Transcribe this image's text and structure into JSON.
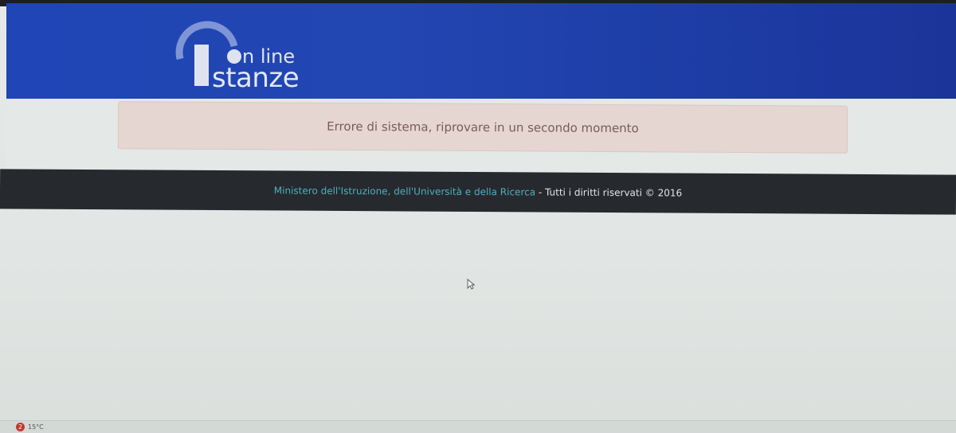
{
  "header": {
    "logo": {
      "online_text": "n line",
      "stanze_text": "stanze"
    }
  },
  "alert": {
    "message": "Errore di sistema, riprovare in un secondo momento"
  },
  "footer": {
    "ministry_link": "Ministero dell'Istruzione, dell'Università e della Ricerca",
    "rights_text": " - Tutti i diritti riservati © 2016"
  },
  "taskbar": {
    "weather_badge": "2",
    "temperature": "15°C"
  },
  "colors": {
    "header_blue": "#1f45b6",
    "alert_bg": "#e6d6d2",
    "alert_text": "#7a5a54",
    "footer_bg": "#26292d",
    "footer_link": "#4fb0c2"
  },
  "icons": [
    "logo-arc-icon",
    "cursor-icon",
    "weather-icon"
  ]
}
